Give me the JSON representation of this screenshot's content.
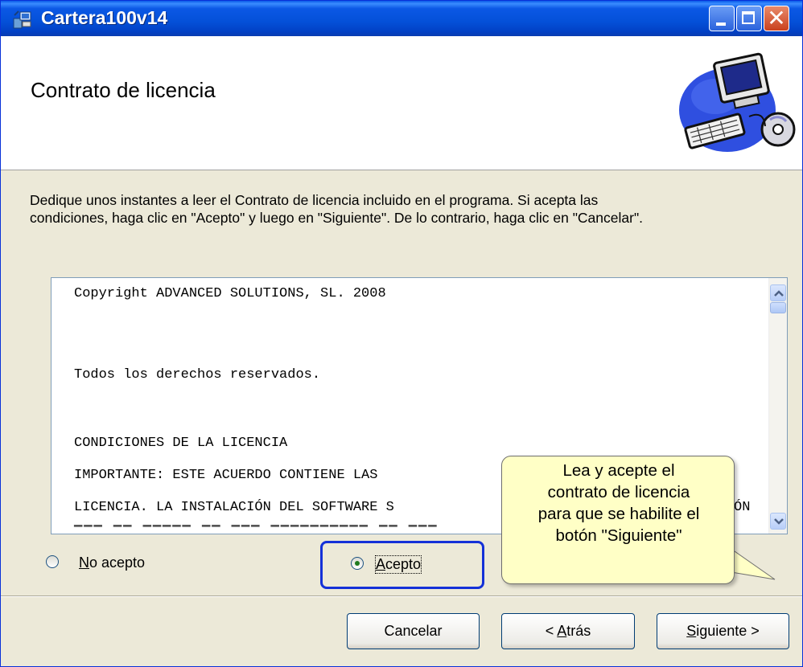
{
  "window": {
    "title": "Cartera100v14",
    "controls": {
      "minimize_icon": "minimize-icon",
      "maximize_icon": "maximize-icon",
      "close_icon": "close-icon"
    }
  },
  "header": {
    "title": "Contrato de licencia",
    "art_icon": "computer-cd-icon"
  },
  "instructions": {
    "line1": "Dedique unos instantes a leer el Contrato de licencia incluido en el programa. Si acepta las",
    "line2": "condiciones, haga clic en \"Acepto\" y luego en \"Siguiente\". De lo contrario, haga clic en \"Cancelar\"."
  },
  "license": {
    "lines": [
      "Copyright ADVANCED SOLUTIONS, SL. 2008",
      "Todos los derechos reservados.",
      "CONDICIONES DE LA LICENCIA",
      "IMPORTANTE: ESTE ACUERDO CONTIENE LAS",
      "LICENCIA. LA INSTALACIÓN DEL SOFTWARE S",
      "ÓN"
    ]
  },
  "options": {
    "reject": {
      "label_underlined": "N",
      "label_rest": "o acepto",
      "checked": false
    },
    "accept": {
      "label_underlined": "A",
      "label_rest": "cepto",
      "checked": true
    }
  },
  "callout": {
    "lines": [
      "Lea y acepte el",
      "contrato de licencia",
      "para que se habilite el",
      "botón \"Siguiente\""
    ]
  },
  "buttons": {
    "cancel": "Cancelar",
    "back_prefix": "< ",
    "back_underlined": "A",
    "back_rest": "trás",
    "next_underlined": "S",
    "next_rest": "iguiente >"
  },
  "colors": {
    "titlebar": "#0450d8",
    "dialog_bg": "#ece9d8",
    "highlight": "#1431d8",
    "callout_bg": "#ffffc6"
  }
}
